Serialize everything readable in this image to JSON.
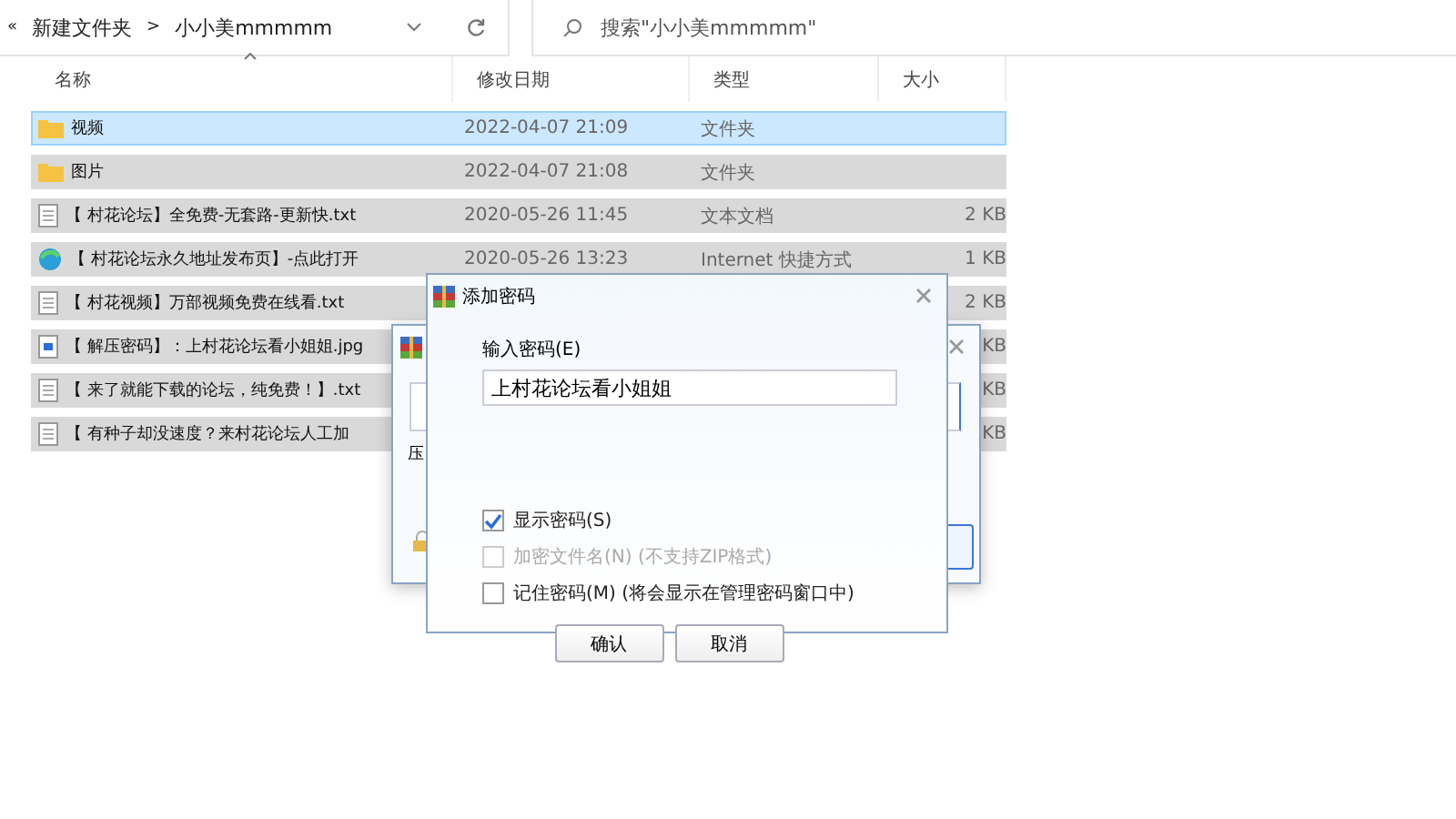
{
  "address_bar": {
    "back": "«",
    "path": [
      "新建文件夹",
      "小小美mmmmm"
    ],
    "separator": ">"
  },
  "search": {
    "placeholder": "搜索\"小小美mmmmm\""
  },
  "file_list": {
    "columns": [
      "名称",
      "修改日期",
      "类型",
      "大小"
    ],
    "rows": [
      {
        "kind": "folder",
        "name": "视频",
        "date": "2022-04-07 21:09",
        "type": "文件夹",
        "selected": true
      },
      {
        "kind": "folder",
        "name": "图片",
        "date": "2022-04-07 21:08",
        "type": "文件夹",
        "selected": false
      },
      {
        "kind": "text",
        "name": "【 村花论坛】全免费-无套路-更新快.txt",
        "date": "2020-05-26 11:45",
        "type": "文本文档",
        "size": "2 KB",
        "selected": false
      },
      {
        "kind": "link",
        "name": "【 村花论坛永久地址发布页】-点此打开",
        "date": "2020-05-26 13:23",
        "type": "Internet 快捷方式",
        "size": "1 KB",
        "selected": false
      },
      {
        "kind": "text",
        "name": "【 村花视频】万部视频免费在线看.txt",
        "size": "2 KB",
        "selected": false
      },
      {
        "kind": "image",
        "name": "【 解压密码】：上村花论坛看小姐姐.jpg",
        "size": "KB",
        "selected": false
      },
      {
        "kind": "text",
        "name": "【 来了就能下载的论坛，纯免费！】.txt",
        "size": "KB",
        "selected": false
      },
      {
        "kind": "text",
        "name": "【 有种子却没速度？来村花论坛人工加",
        "size": "KB",
        "selected": false
      }
    ]
  },
  "back_dialog": {
    "label_1": "压"
  },
  "password_dialog": {
    "title": "添加密码",
    "field_label": "输入密码(E)",
    "password": "上村花论坛看小姐姐",
    "options": [
      {
        "label": "显示密码(S)",
        "checked": true,
        "disabled": false
      },
      {
        "label": "加密文件名(N) (不支持ZIP格式)",
        "checked": false,
        "disabled": true
      },
      {
        "label": "记住密码(M) (将会显示在管理密码窗口中)",
        "checked": false,
        "disabled": false
      }
    ],
    "buttons": [
      "确认",
      "取消"
    ]
  }
}
